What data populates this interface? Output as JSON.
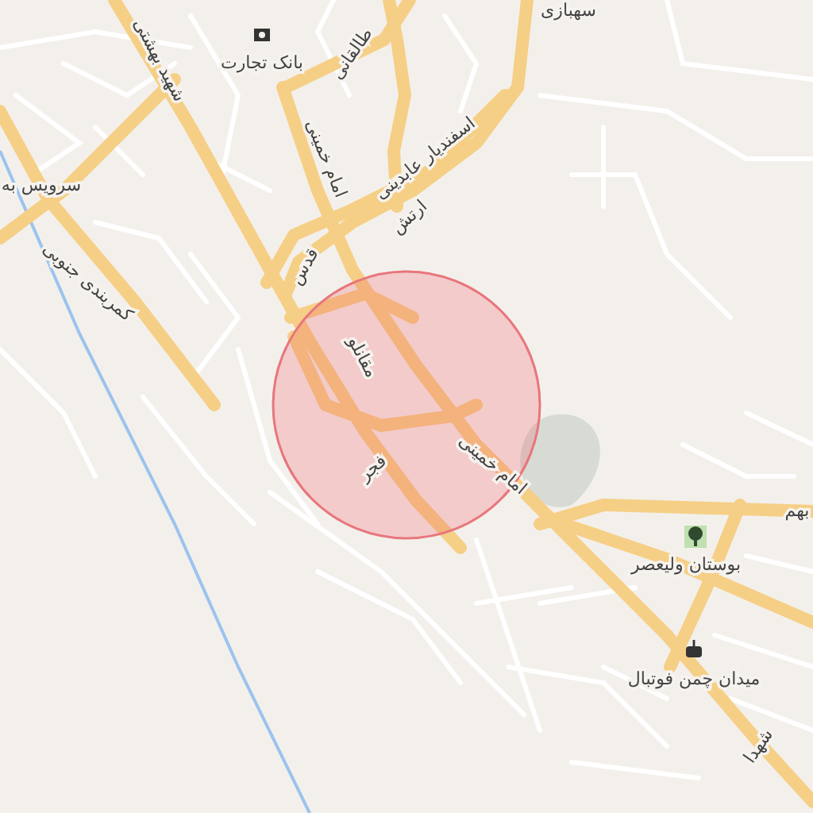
{
  "map": {
    "labels": [
      {
        "kind": "place",
        "text": "سهبازی"
      },
      {
        "kind": "bank",
        "text": "بانک تجارت"
      },
      {
        "kind": "road",
        "text": "طالقانی"
      },
      {
        "kind": "road",
        "text": "شهید بهشتی"
      },
      {
        "kind": "road",
        "text": "امام خمینی"
      },
      {
        "kind": "road",
        "text": "اسفندیار عابدینی"
      },
      {
        "kind": "place",
        "text": "سرویس به"
      },
      {
        "kind": "road",
        "text": "ارتش"
      },
      {
        "kind": "road",
        "text": "قدس"
      },
      {
        "kind": "road",
        "text": "کمربندی جنوبی"
      },
      {
        "kind": "road",
        "text": "مقانلو"
      },
      {
        "kind": "road",
        "text": "امام خمینی"
      },
      {
        "kind": "road",
        "text": "فجر"
      },
      {
        "kind": "road",
        "text": "بهم"
      },
      {
        "kind": "park",
        "text": "بوستان ولیعصر"
      },
      {
        "kind": "stadium",
        "text": "میدان چمن فوتبال"
      },
      {
        "kind": "road",
        "text": "شهدا"
      }
    ]
  }
}
